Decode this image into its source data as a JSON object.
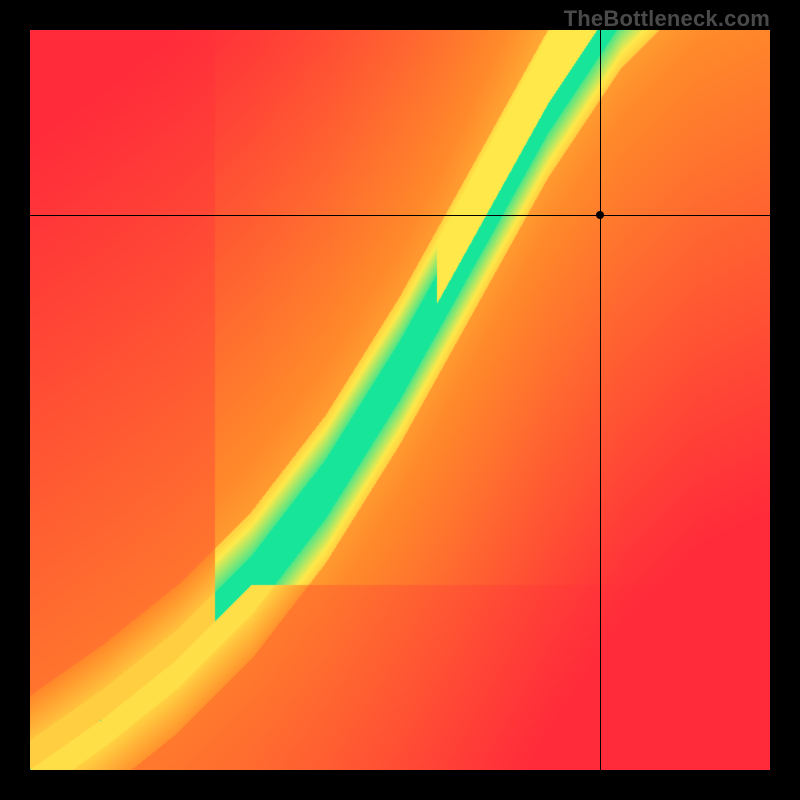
{
  "watermark": "TheBottleneck.com",
  "chart_data": {
    "type": "heatmap",
    "title": "",
    "xlabel": "",
    "ylabel": "",
    "xlim": [
      0,
      1
    ],
    "ylim": [
      0,
      1
    ],
    "grid": false,
    "legend": false,
    "ideal_curve": [
      {
        "x": 0.0,
        "y": 0.0
      },
      {
        "x": 0.1,
        "y": 0.07
      },
      {
        "x": 0.2,
        "y": 0.15
      },
      {
        "x": 0.3,
        "y": 0.25
      },
      {
        "x": 0.4,
        "y": 0.38
      },
      {
        "x": 0.5,
        "y": 0.54
      },
      {
        "x": 0.6,
        "y": 0.72
      },
      {
        "x": 0.7,
        "y": 0.9
      },
      {
        "x": 0.8,
        "y": 1.05
      },
      {
        "x": 0.9,
        "y": 1.15
      },
      {
        "x": 1.0,
        "y": 1.2
      }
    ],
    "band_green_half_width": 0.04,
    "band_yellow_half_width": 0.1,
    "crosshair": {
      "x": 0.77,
      "y": 0.75
    },
    "color_stops": {
      "red": "#ff2b3a",
      "orange": "#ff8a2a",
      "yellow": "#ffe94a",
      "green": "#17e59a"
    }
  }
}
